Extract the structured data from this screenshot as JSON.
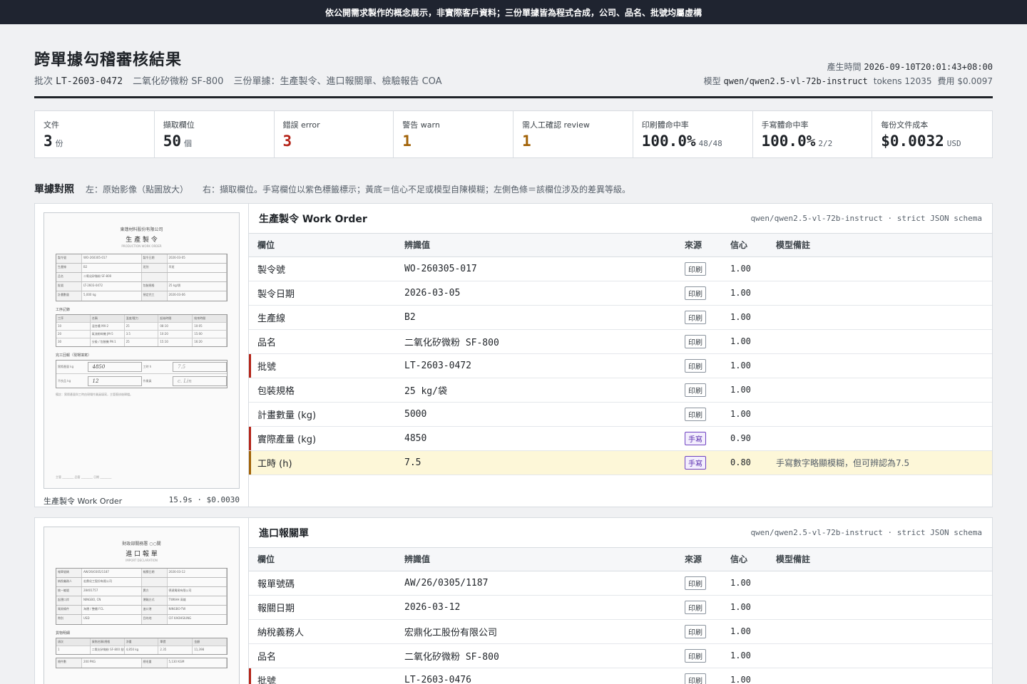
{
  "banner": "依公開需求製作的概念展示，非實際客戶資料；三份單據皆為程式合成，公司、品名、批號均屬虛構",
  "header": {
    "title": "跨單據勾稽審核結果",
    "batch_label": "批次",
    "batch_no": "LT-2603-0472",
    "product": "二氧化矽微粉 SF-800",
    "docs_summary": "三份單據：生產製令、進口報關單、檢驗報告 COA",
    "generated_label": "產生時間",
    "generated_at": "2026-09-10T20:01:43+08:00",
    "model_label": "模型",
    "model": "qwen/qwen2.5-vl-72b-instruct",
    "tokens": "tokens 12035",
    "cost": "費用 $0.0097"
  },
  "stats": [
    {
      "label": "文件",
      "value": "3",
      "unit": "份",
      "tone": ""
    },
    {
      "label": "擷取欄位",
      "value": "50",
      "unit": "個",
      "tone": ""
    },
    {
      "label": "錯誤 error",
      "value": "3",
      "unit": "",
      "tone": "red"
    },
    {
      "label": "警告 warn",
      "value": "1",
      "unit": "",
      "tone": "amber"
    },
    {
      "label": "需人工確認 review",
      "value": "1",
      "unit": "",
      "tone": "amber"
    },
    {
      "label": "印刷體命中率",
      "value": "100.0%",
      "unit": "48/48",
      "tone": ""
    },
    {
      "label": "手寫體命中率",
      "value": "100.0%",
      "unit": "2/2",
      "tone": ""
    },
    {
      "label": "每份文件成本",
      "value": "$0.0032",
      "unit": "USD",
      "tone": ""
    }
  ],
  "section": {
    "title": "單據對照",
    "left_note": "左：原始影像（點圖放大）",
    "right_note": "右：擷取欄位。手寫欄位以紫色標籤標示；黃底＝信心不足或模型自陳模糊；左側色條＝該欄位涉及的差異等級。"
  },
  "columns": {
    "field": "欄位",
    "value": "辨識值",
    "source": "來源",
    "confidence": "信心",
    "note": "模型備註"
  },
  "documents": [
    {
      "title": "生產製令 Work Order",
      "model": "qwen/qwen2.5-vl-72b-instruct · strict JSON schema",
      "caption": "生產製令 Work Order",
      "timing": "15.9s · $0.0030",
      "image": {
        "company": "東蓮材料股份有限公司",
        "heading": "生 產 製 令",
        "sub": "PRODUCTION WORK ORDER",
        "grid": [
          [
            "製令號",
            "WO-260305-017",
            "製令日期",
            "2026-03-05"
          ],
          [
            "生產線",
            "B2",
            "班別",
            "早班"
          ],
          [
            "品名",
            "二氧化矽微粉 SF-800",
            "",
            ""
          ],
          [
            "批號",
            "LT-2603-0472",
            "包裝規格",
            "25 kg/袋"
          ],
          [
            "計畫數量",
            "5,000 kg",
            "預定完工",
            "2026-03-06"
          ]
        ],
        "process_title": "工序記錄",
        "process_rows": [
          [
            "工序",
            "名稱",
            "溫度/壓力",
            "起始時間",
            "結束時間"
          ],
          [
            "10",
            "混合槽 MX-2",
            "25",
            "08:10",
            "10:05"
          ],
          [
            "20",
            "氣流粉碎機 JM-5",
            "3.5",
            "10:20",
            "15:00"
          ],
          [
            "30",
            "分級 / 包裝機 PK-1",
            "25",
            "15:10",
            "16:20"
          ]
        ],
        "hand_title": "完工回報（現場填寫）",
        "hand_rows": [
          [
            "實際產量 kg",
            "4850",
            "工時 h",
            "7.5"
          ],
          [
            "不良品 kg",
            "12",
            "作業員",
            "c. Lin"
          ]
        ],
        "footnote": "備註：實際產量與工時由現場作業員填寫，主管簽核後歸檔。",
        "sign": "主管 ________  品管 ________  日期 ________"
      },
      "fields": [
        {
          "field": "製令號",
          "value": "WO-260305-017",
          "source": "印刷",
          "conf": "1.00",
          "note": "",
          "flag": ""
        },
        {
          "field": "製令日期",
          "value": "2026-03-05",
          "source": "印刷",
          "conf": "1.00",
          "note": "",
          "flag": ""
        },
        {
          "field": "生產線",
          "value": "B2",
          "source": "印刷",
          "conf": "1.00",
          "note": "",
          "flag": ""
        },
        {
          "field": "品名",
          "value": "二氧化矽微粉 SF-800",
          "source": "印刷",
          "conf": "1.00",
          "note": "",
          "flag": ""
        },
        {
          "field": "批號",
          "value": "LT-2603-0472",
          "source": "印刷",
          "conf": "1.00",
          "note": "",
          "flag": "error"
        },
        {
          "field": "包裝規格",
          "value": "25 kg/袋",
          "source": "印刷",
          "conf": "1.00",
          "note": "",
          "flag": ""
        },
        {
          "field": "計畫數量 (kg)",
          "value": "5000",
          "source": "印刷",
          "conf": "1.00",
          "note": "",
          "flag": ""
        },
        {
          "field": "實際產量 (kg)",
          "value": "4850",
          "source": "手寫",
          "conf": "0.90",
          "note": "",
          "flag": "error"
        },
        {
          "field": "工時 (h)",
          "value": "7.5",
          "source": "手寫",
          "conf": "0.80",
          "note": "手寫數字略顯模糊，但可辨認為7.5",
          "flag": "warn",
          "low": true
        }
      ]
    },
    {
      "title": "進口報關單",
      "model": "qwen/qwen2.5-vl-72b-instruct · strict JSON schema",
      "image": {
        "company": "財政部關務署 ○○關",
        "heading": "進 口 報 單",
        "sub": "IMPORT DECLARATION",
        "grid": [
          [
            "報單號碼",
            "AW/26/0305/1187",
            "報關日期",
            "2026-03-12"
          ],
          [
            "納稅義務人",
            "宏鼎化工股份有限公司",
            "",
            ""
          ],
          [
            "統一編號",
            "28401757",
            "賣方",
            "德達貿易有限公司"
          ],
          [
            "起運口岸",
            "NINGBO, CN",
            "運輸方式",
            "TWKHH 高雄"
          ],
          [
            "貿易條件",
            "海運 / 整櫃 FCL",
            "進口港",
            "NINGBO-TW"
          ],
          [
            "幣別",
            "USD",
            "目的地",
            "CIF KAOHSIUNG"
          ]
        ],
        "goods_title": "貨物明細",
        "goods_rows": [
          [
            "項次",
            "貨物名稱/規格",
            "淨重",
            "單價",
            "金額"
          ],
          [
            "1",
            "二氧化矽微粉 SF-800 批號 LT-2603-0476",
            "4,850 kg",
            "2.35",
            "11,398"
          ]
        ],
        "extra_rows": [
          [
            "總件數",
            "200 PKG",
            "總毛重",
            "5,130 KGM"
          ]
        ]
      },
      "fields": [
        {
          "field": "報單號碼",
          "value": "AW/26/0305/1187",
          "source": "印刷",
          "conf": "1.00",
          "note": "",
          "flag": ""
        },
        {
          "field": "報關日期",
          "value": "2026-03-12",
          "source": "印刷",
          "conf": "1.00",
          "note": "",
          "flag": ""
        },
        {
          "field": "納稅義務人",
          "value": "宏鼎化工股份有限公司",
          "source": "印刷",
          "conf": "1.00",
          "note": "",
          "flag": ""
        },
        {
          "field": "品名",
          "value": "二氧化矽微粉 SF-800",
          "source": "印刷",
          "conf": "1.00",
          "note": "",
          "flag": ""
        },
        {
          "field": "批號",
          "value": "LT-2603-0476",
          "source": "印刷",
          "conf": "1.00",
          "note": "",
          "flag": "error"
        }
      ]
    }
  ]
}
